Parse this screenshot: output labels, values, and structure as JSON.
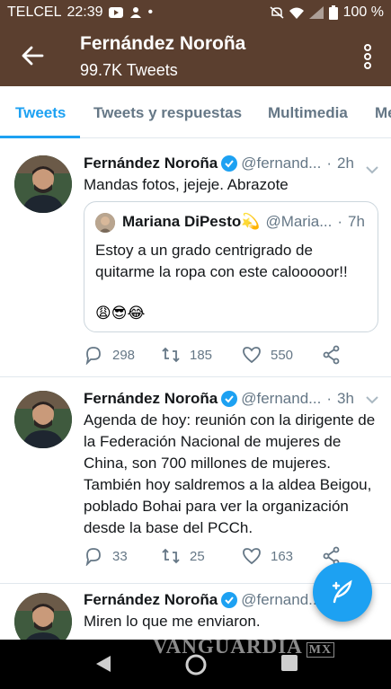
{
  "status_bar": {
    "carrier": "TELCEL",
    "time": "22:39",
    "battery": "100 %",
    "dot": "•"
  },
  "header": {
    "title": "Fernández Noroña",
    "subtitle": "99.7K Tweets"
  },
  "tabs": [
    {
      "label": "Tweets",
      "active": true
    },
    {
      "label": "Tweets y respuestas",
      "active": false
    },
    {
      "label": "Multimedia",
      "active": false
    },
    {
      "label": "Me",
      "active": false
    }
  ],
  "tweets": [
    {
      "name": "Fernández Noroña",
      "handle": "@fernand...",
      "dot": "·",
      "time": "2h",
      "text": "Mandas fotos, jejeje. Abrazote",
      "quote": {
        "name": "Mariana DiPesto",
        "name_emoji": "💫",
        "handle": "@Maria...",
        "dot": "·",
        "time": "7h",
        "text": "Estoy a un grado centrigrado de quitarme la ropa con este calooooor!!",
        "emoji": "😩😎😂"
      },
      "replies": "298",
      "retweets": "185",
      "likes": "550"
    },
    {
      "name": "Fernández Noroña",
      "handle": "@fernand...",
      "dot": "·",
      "time": "3h",
      "text": "Agenda de hoy: reunión con la dirigente de la Federación Nacional de mujeres de China, son 700 millones de mujeres. También hoy saldremos a la aldea Beigou, poblado  Bohai para ver la organización desde la base del PCCh.",
      "replies": "33",
      "retweets": "25",
      "likes": "163"
    },
    {
      "name": "Fernández Noroña",
      "handle": "@fernand...",
      "dot": "·",
      "time": "",
      "text": "Miren lo que me enviaron."
    }
  ],
  "watermark": "VANGUARDIA",
  "watermark_suffix": "MX",
  "colors": {
    "header_bg": "#5b3f2f",
    "accent": "#1da1f2",
    "secondary_text": "#657786"
  },
  "icons": {
    "back": "arrow-left-icon",
    "more": "more-vertical-icon",
    "verified": "verified-badge-icon",
    "reply": "reply-icon",
    "retweet": "retweet-icon",
    "like": "heart-icon",
    "share": "share-icon",
    "compose": "compose-tweet-icon"
  }
}
